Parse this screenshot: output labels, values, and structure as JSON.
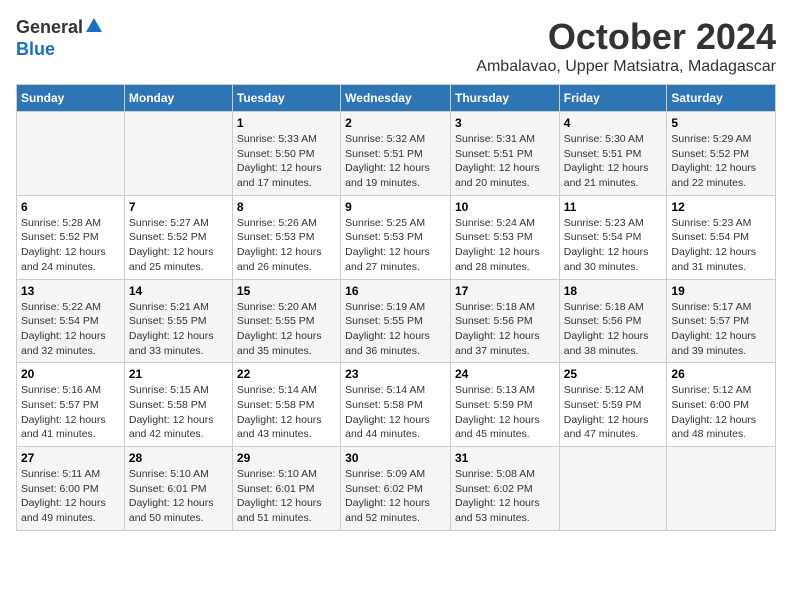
{
  "logo": {
    "general": "General",
    "blue": "Blue"
  },
  "title": {
    "month_year": "October 2024",
    "location": "Ambalavao, Upper Matsiatra, Madagascar"
  },
  "headers": [
    "Sunday",
    "Monday",
    "Tuesday",
    "Wednesday",
    "Thursday",
    "Friday",
    "Saturday"
  ],
  "weeks": [
    [
      {
        "day": "",
        "content": ""
      },
      {
        "day": "",
        "content": ""
      },
      {
        "day": "1",
        "content": "Sunrise: 5:33 AM\nSunset: 5:50 PM\nDaylight: 12 hours\nand 17 minutes."
      },
      {
        "day": "2",
        "content": "Sunrise: 5:32 AM\nSunset: 5:51 PM\nDaylight: 12 hours\nand 19 minutes."
      },
      {
        "day": "3",
        "content": "Sunrise: 5:31 AM\nSunset: 5:51 PM\nDaylight: 12 hours\nand 20 minutes."
      },
      {
        "day": "4",
        "content": "Sunrise: 5:30 AM\nSunset: 5:51 PM\nDaylight: 12 hours\nand 21 minutes."
      },
      {
        "day": "5",
        "content": "Sunrise: 5:29 AM\nSunset: 5:52 PM\nDaylight: 12 hours\nand 22 minutes."
      }
    ],
    [
      {
        "day": "6",
        "content": "Sunrise: 5:28 AM\nSunset: 5:52 PM\nDaylight: 12 hours\nand 24 minutes."
      },
      {
        "day": "7",
        "content": "Sunrise: 5:27 AM\nSunset: 5:52 PM\nDaylight: 12 hours\nand 25 minutes."
      },
      {
        "day": "8",
        "content": "Sunrise: 5:26 AM\nSunset: 5:53 PM\nDaylight: 12 hours\nand 26 minutes."
      },
      {
        "day": "9",
        "content": "Sunrise: 5:25 AM\nSunset: 5:53 PM\nDaylight: 12 hours\nand 27 minutes."
      },
      {
        "day": "10",
        "content": "Sunrise: 5:24 AM\nSunset: 5:53 PM\nDaylight: 12 hours\nand 28 minutes."
      },
      {
        "day": "11",
        "content": "Sunrise: 5:23 AM\nSunset: 5:54 PM\nDaylight: 12 hours\nand 30 minutes."
      },
      {
        "day": "12",
        "content": "Sunrise: 5:23 AM\nSunset: 5:54 PM\nDaylight: 12 hours\nand 31 minutes."
      }
    ],
    [
      {
        "day": "13",
        "content": "Sunrise: 5:22 AM\nSunset: 5:54 PM\nDaylight: 12 hours\nand 32 minutes."
      },
      {
        "day": "14",
        "content": "Sunrise: 5:21 AM\nSunset: 5:55 PM\nDaylight: 12 hours\nand 33 minutes."
      },
      {
        "day": "15",
        "content": "Sunrise: 5:20 AM\nSunset: 5:55 PM\nDaylight: 12 hours\nand 35 minutes."
      },
      {
        "day": "16",
        "content": "Sunrise: 5:19 AM\nSunset: 5:55 PM\nDaylight: 12 hours\nand 36 minutes."
      },
      {
        "day": "17",
        "content": "Sunrise: 5:18 AM\nSunset: 5:56 PM\nDaylight: 12 hours\nand 37 minutes."
      },
      {
        "day": "18",
        "content": "Sunrise: 5:18 AM\nSunset: 5:56 PM\nDaylight: 12 hours\nand 38 minutes."
      },
      {
        "day": "19",
        "content": "Sunrise: 5:17 AM\nSunset: 5:57 PM\nDaylight: 12 hours\nand 39 minutes."
      }
    ],
    [
      {
        "day": "20",
        "content": "Sunrise: 5:16 AM\nSunset: 5:57 PM\nDaylight: 12 hours\nand 41 minutes."
      },
      {
        "day": "21",
        "content": "Sunrise: 5:15 AM\nSunset: 5:58 PM\nDaylight: 12 hours\nand 42 minutes."
      },
      {
        "day": "22",
        "content": "Sunrise: 5:14 AM\nSunset: 5:58 PM\nDaylight: 12 hours\nand 43 minutes."
      },
      {
        "day": "23",
        "content": "Sunrise: 5:14 AM\nSunset: 5:58 PM\nDaylight: 12 hours\nand 44 minutes."
      },
      {
        "day": "24",
        "content": "Sunrise: 5:13 AM\nSunset: 5:59 PM\nDaylight: 12 hours\nand 45 minutes."
      },
      {
        "day": "25",
        "content": "Sunrise: 5:12 AM\nSunset: 5:59 PM\nDaylight: 12 hours\nand 47 minutes."
      },
      {
        "day": "26",
        "content": "Sunrise: 5:12 AM\nSunset: 6:00 PM\nDaylight: 12 hours\nand 48 minutes."
      }
    ],
    [
      {
        "day": "27",
        "content": "Sunrise: 5:11 AM\nSunset: 6:00 PM\nDaylight: 12 hours\nand 49 minutes."
      },
      {
        "day": "28",
        "content": "Sunrise: 5:10 AM\nSunset: 6:01 PM\nDaylight: 12 hours\nand 50 minutes."
      },
      {
        "day": "29",
        "content": "Sunrise: 5:10 AM\nSunset: 6:01 PM\nDaylight: 12 hours\nand 51 minutes."
      },
      {
        "day": "30",
        "content": "Sunrise: 5:09 AM\nSunset: 6:02 PM\nDaylight: 12 hours\nand 52 minutes."
      },
      {
        "day": "31",
        "content": "Sunrise: 5:08 AM\nSunset: 6:02 PM\nDaylight: 12 hours\nand 53 minutes."
      },
      {
        "day": "",
        "content": ""
      },
      {
        "day": "",
        "content": ""
      }
    ]
  ]
}
